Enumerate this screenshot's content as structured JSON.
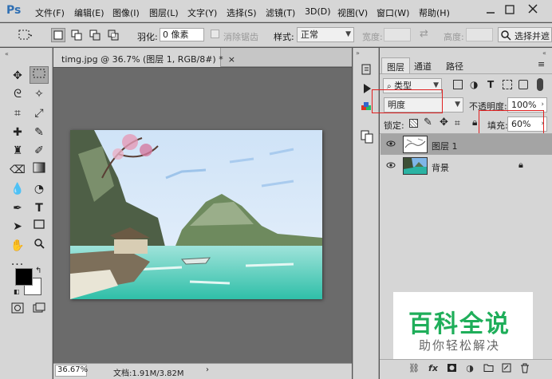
{
  "app": {
    "logo": "Ps",
    "menu": [
      "文件(F)",
      "编辑(E)",
      "图像(I)",
      "图层(L)",
      "文字(Y)",
      "选择(S)",
      "滤镜(T)",
      "3D(D)",
      "视图(V)",
      "窗口(W)",
      "帮助(H)"
    ]
  },
  "options": {
    "feather_label": "羽化:",
    "feather_value": "0 像素",
    "antialias_label": "消除锯齿",
    "style_label": "样式:",
    "style_value": "正常",
    "width_label": "宽度:",
    "height_label": "高度:",
    "select_mask_label": "选择并遮"
  },
  "document": {
    "tab_title": "timg.jpg @ 36.7% (图层 1, RGB/8#) *",
    "zoom": "36.67%",
    "doc_info": "文档:1.91M/3.82M"
  },
  "layers_panel": {
    "tabs": [
      "图层",
      "通道",
      "路径"
    ],
    "filter_kind": "类型",
    "blend_mode": "明度",
    "opacity_label": "不透明度:",
    "opacity_value": "100%",
    "lock_label": "锁定:",
    "fill_label": "填充:",
    "fill_value": "60%",
    "layers": [
      {
        "name": "图层 1",
        "selected": true
      },
      {
        "name": "背景",
        "locked": true
      }
    ]
  },
  "watermark": {
    "big": "百科全说",
    "small": "助你轻松解决"
  },
  "colors": {
    "highlight": "#e02020",
    "watermark_green": "#1fae5a"
  },
  "icons": [
    "move-icon",
    "marquee-icon",
    "lasso-icon",
    "magic-wand-icon",
    "crop-icon",
    "eyedropper-icon",
    "healing-brush-icon",
    "brush-icon",
    "clone-stamp-icon",
    "history-brush-icon",
    "eraser-icon",
    "gradient-icon",
    "blur-icon",
    "dodge-icon",
    "pen-icon",
    "text-icon",
    "path-select-icon",
    "rectangle-icon",
    "hand-icon",
    "zoom-icon",
    "eye-icon",
    "lock-icon"
  ]
}
